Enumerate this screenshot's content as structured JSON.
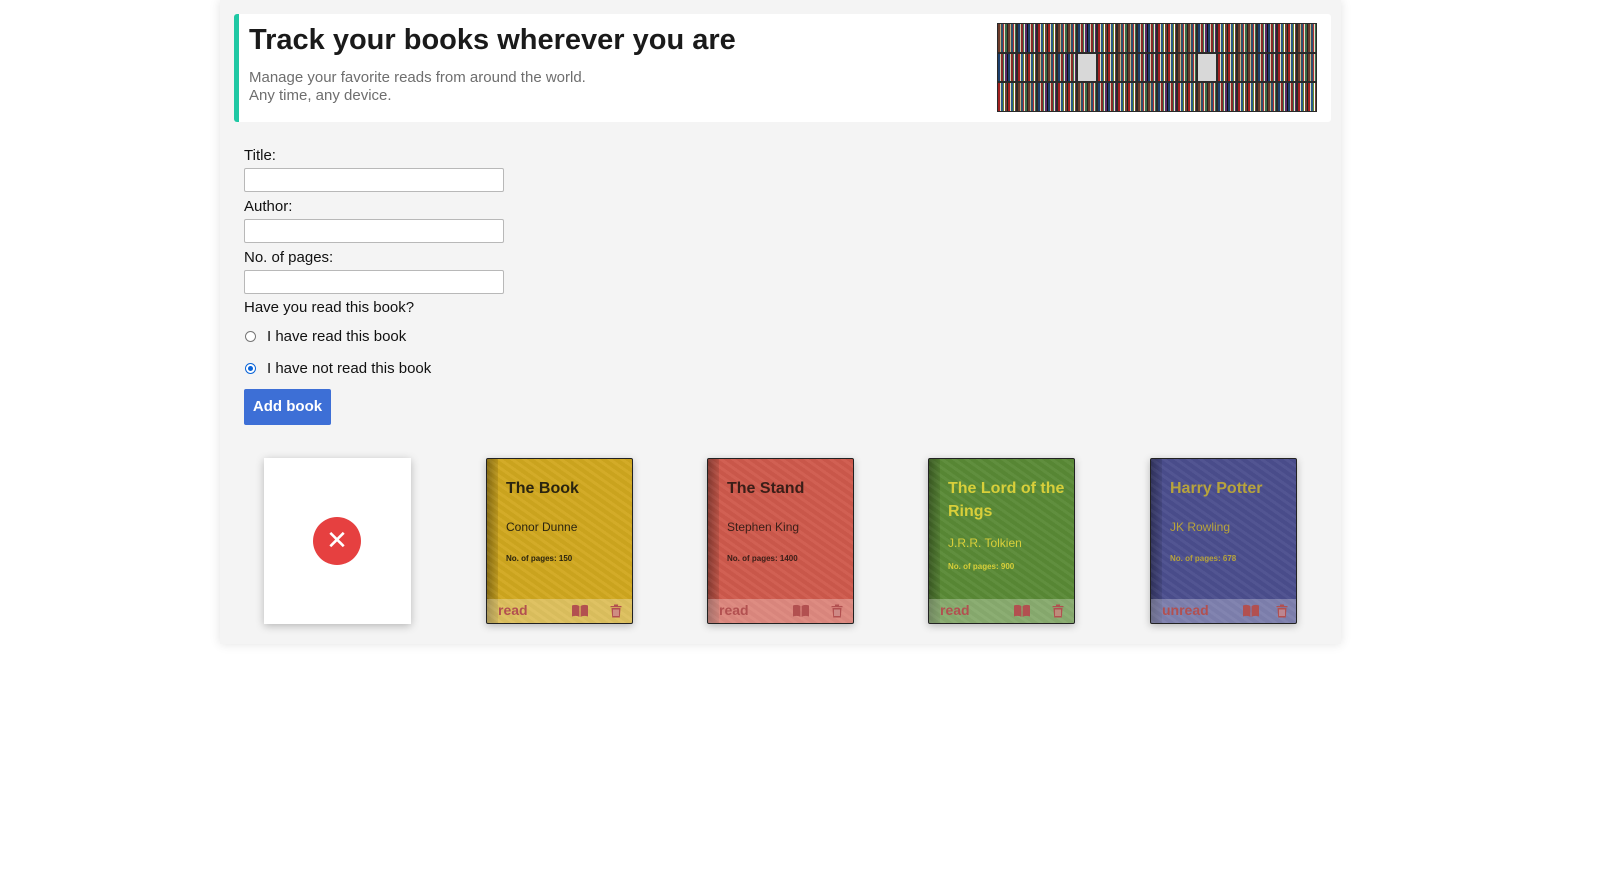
{
  "header": {
    "title": "Track your books wherever you are",
    "subtitle_line1": "Manage your favorite reads from around the world.",
    "subtitle_line2": "Any time, any device."
  },
  "form": {
    "title_label": "Title:",
    "title_value": "",
    "author_label": "Author:",
    "author_value": "",
    "pages_label": "No. of pages:",
    "pages_value": "",
    "question": "Have you read this book?",
    "radio_read_label": "I have read this book",
    "radio_not_read_label": "I have not read this book",
    "selected_option": "not_read",
    "add_button": "Add book"
  },
  "empty_card_icon": "close-icon",
  "books": [
    {
      "title": "The Book",
      "author": "Conor Dunne",
      "pages": "No. of pages: 150",
      "status": "read",
      "color": "#d1a81f",
      "text_color": "#2a2410"
    },
    {
      "title": "The Stand",
      "author": "Stephen King",
      "pages": "No. of pages: 1400",
      "status": "read",
      "color": "#cf5a4c",
      "text_color": "#3a1e18"
    },
    {
      "title": "The Lord of the Rings",
      "author": "J.R.R. Tolkien",
      "pages": "No. of pages: 900",
      "status": "read",
      "color": "#5a8a36",
      "text_color": "#d8cf3a"
    },
    {
      "title": "Harry Potter",
      "author": "JK Rowling",
      "pages": "No. of pages: 678",
      "status": "unread",
      "color": "#4b4e8e",
      "text_color": "#b7a33c"
    }
  ],
  "colors": {
    "accent": "#1fc8a4",
    "button": "#3d6fd6",
    "status_text": "#b25050",
    "close_circle": "#e64040"
  },
  "icons": [
    "book-open-icon",
    "trash-icon",
    "close-icon"
  ]
}
